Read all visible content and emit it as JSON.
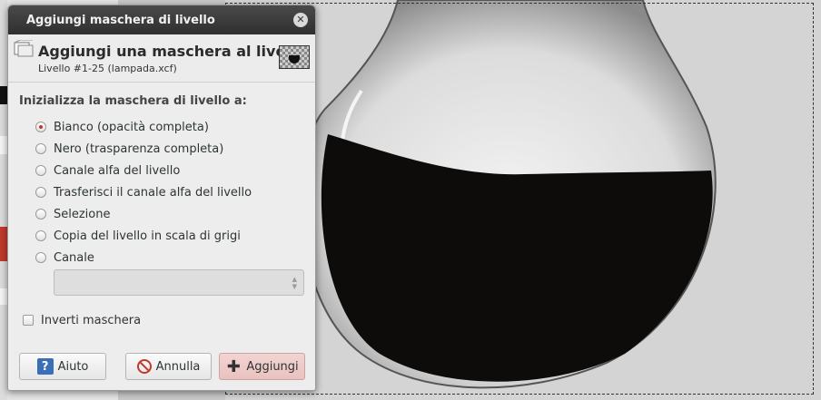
{
  "window": {
    "title": "Aggiungi maschera di livello"
  },
  "header": {
    "title": "Aggiungi una maschera al livello",
    "subtitle": "Livello #1-25 (lampada.xcf)"
  },
  "section_title": "Inizializza la maschera di livello a:",
  "radio_options": [
    {
      "label": "Bianco (opacità completa)",
      "checked": true
    },
    {
      "label": "Nero (trasparenza completa)",
      "checked": false
    },
    {
      "label": "Canale alfa del livello",
      "checked": false
    },
    {
      "label": "Trasferisci il canale alfa del livello",
      "checked": false
    },
    {
      "label": "Selezione",
      "checked": false
    },
    {
      "label": "Copia del livello in scala di grigi",
      "checked": false
    },
    {
      "label": "Canale",
      "checked": false
    }
  ],
  "channel_combo": {
    "value": ""
  },
  "invert": {
    "label": "Inverti maschera",
    "checked": false
  },
  "buttons": {
    "help": "Aiuto",
    "cancel": "Annulla",
    "add": "Aggiungi"
  },
  "icons": {
    "help": "help-icon",
    "cancel": "cancel-icon",
    "add": "plus-icon",
    "close": "close-icon",
    "header": "layer-mask-icon"
  },
  "colors": {
    "accent": "#c0392b",
    "titlebar": "#3a3a3a",
    "add_button": "#eccac7"
  }
}
